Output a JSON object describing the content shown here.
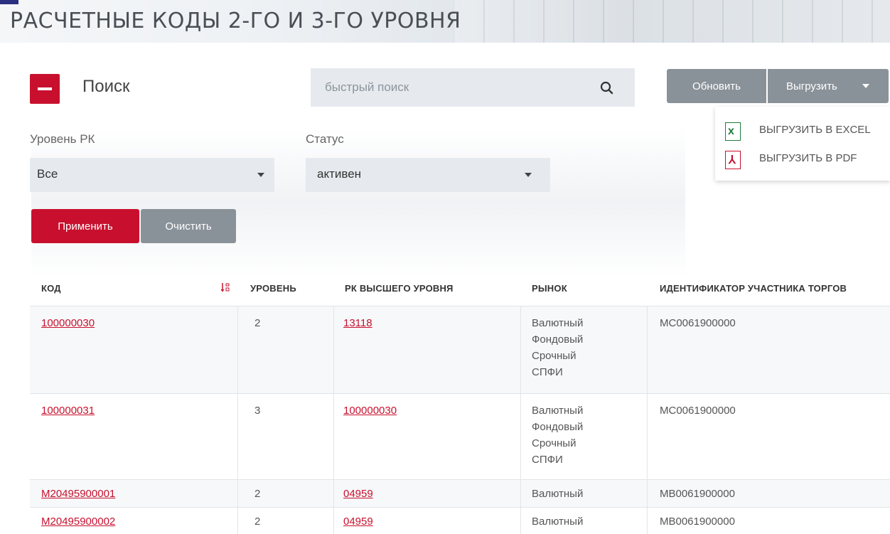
{
  "header": {
    "title": "РАСЧЕТНЫЕ КОДЫ 2-ГО И 3-ГО УРОВНЯ"
  },
  "search": {
    "title": "Поиск",
    "quick_placeholder": "быстрый поиск",
    "refresh_label": "Обновить",
    "export_label": "Выгрузить",
    "export_menu": [
      {
        "label": "ВЫГРУЗИТЬ В EXCEL",
        "icon": "excel-icon"
      },
      {
        "label": "ВЫГРУЗИТЬ В PDF",
        "icon": "pdf-icon"
      }
    ]
  },
  "filters": {
    "level_label": "Уровень РК",
    "level_value": "Все",
    "status_label": "Статус",
    "status_value": "активен",
    "apply_label": "Применить",
    "clear_label": "Очистить"
  },
  "table": {
    "columns": [
      "КОД",
      "УРОВЕНЬ",
      "РК ВЫСШЕГО УРОВНЯ",
      "РЫНОК",
      "ИДЕНТИФИКАТОР УЧАСТНИКА ТОРГОВ"
    ],
    "rows": [
      {
        "code": "100000030",
        "level": "2",
        "parent": "13118",
        "market": [
          "Валютный",
          "Фондовый",
          "Срочный",
          "СПФИ"
        ],
        "trader_id": "MC0061900000"
      },
      {
        "code": "100000031",
        "level": "3",
        "parent": "100000030",
        "market": [
          "Валютный",
          "Фондовый",
          "Срочный",
          "СПФИ"
        ],
        "trader_id": "MC0061900000"
      },
      {
        "code": "M20495900001",
        "level": "2",
        "parent": "04959",
        "market": [
          "Валютный"
        ],
        "trader_id": "MB0061900000"
      },
      {
        "code": "M20495900002",
        "level": "2",
        "parent": "04959",
        "market": [
          "Валютный"
        ],
        "trader_id": "MB0061900000"
      }
    ]
  },
  "colors": {
    "accent": "#c8102e",
    "gray_button": "#8a9299",
    "input_bg": "#e6eaee"
  }
}
